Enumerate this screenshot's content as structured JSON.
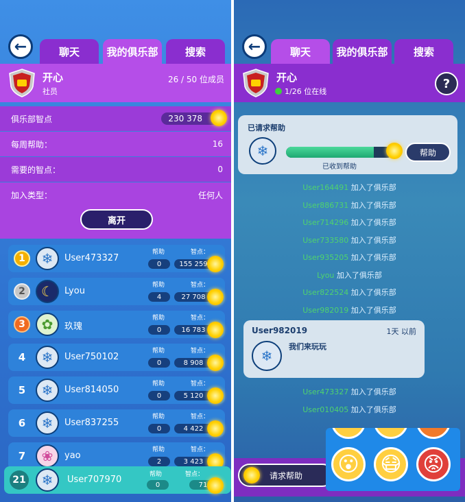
{
  "left": {
    "tabs": [
      "聊天",
      "我的俱乐部",
      "搜索"
    ],
    "club": {
      "name": "开心",
      "role": "社员",
      "members": "26 / 50 位成员"
    },
    "stats": [
      {
        "label": "俱乐部智点",
        "value": "230 378"
      },
      {
        "label": "每周帮助：",
        "value": "16"
      },
      {
        "label": "需要的智点：",
        "value": "0"
      },
      {
        "label": "加入类型：",
        "value": "任何人"
      }
    ],
    "leave_label": "离开",
    "help_label": "帮助",
    "points_label": "智点：",
    "members": [
      {
        "rank": "1",
        "name": "User473327",
        "help": "0",
        "points": "155 259",
        "avatar": "snowflake-icon"
      },
      {
        "rank": "2",
        "name": "Lyou",
        "help": "4",
        "points": "27 708",
        "avatar": "moon-icon"
      },
      {
        "rank": "3",
        "name": "玖瑰",
        "help": "0",
        "points": "16 783",
        "avatar": "bamboo-icon"
      },
      {
        "rank": "4",
        "name": "User750102",
        "help": "0",
        "points": "8 908",
        "avatar": "snowflake-icon"
      },
      {
        "rank": "5",
        "name": "User814050",
        "help": "0",
        "points": "5 120",
        "avatar": "snowflake-icon"
      },
      {
        "rank": "6",
        "name": "User837255",
        "help": "0",
        "points": "4 422",
        "avatar": "snowflake-icon"
      },
      {
        "rank": "7",
        "name": "yao",
        "help": "2",
        "points": "3 423",
        "avatar": "blossom-icon"
      }
    ],
    "self": {
      "rank": "21",
      "name": "User707970",
      "help": "0",
      "points": "71"
    }
  },
  "right": {
    "tabs": [
      "聊天",
      "我的俱乐部",
      "搜索"
    ],
    "club": {
      "name": "开心",
      "online": "1/26 位在线"
    },
    "help_card": {
      "title": "已请求帮助",
      "status": "已收到帮助",
      "button": "帮助",
      "progress": 0.82
    },
    "feed_suffix": "加入了俱乐部",
    "feed_users": [
      "User164491",
      "User886731",
      "User714296",
      "User733580",
      "User935205",
      "Lyou",
      "User822524",
      "User982019"
    ],
    "message": {
      "user": "User982019",
      "time": "1天 以前",
      "text": "我们来玩玩"
    },
    "feed_users_after": [
      "User473327",
      "User010405"
    ],
    "request_help_label": "请求帮助",
    "emojis": [
      "😮",
      "😷",
      "😡"
    ]
  }
}
